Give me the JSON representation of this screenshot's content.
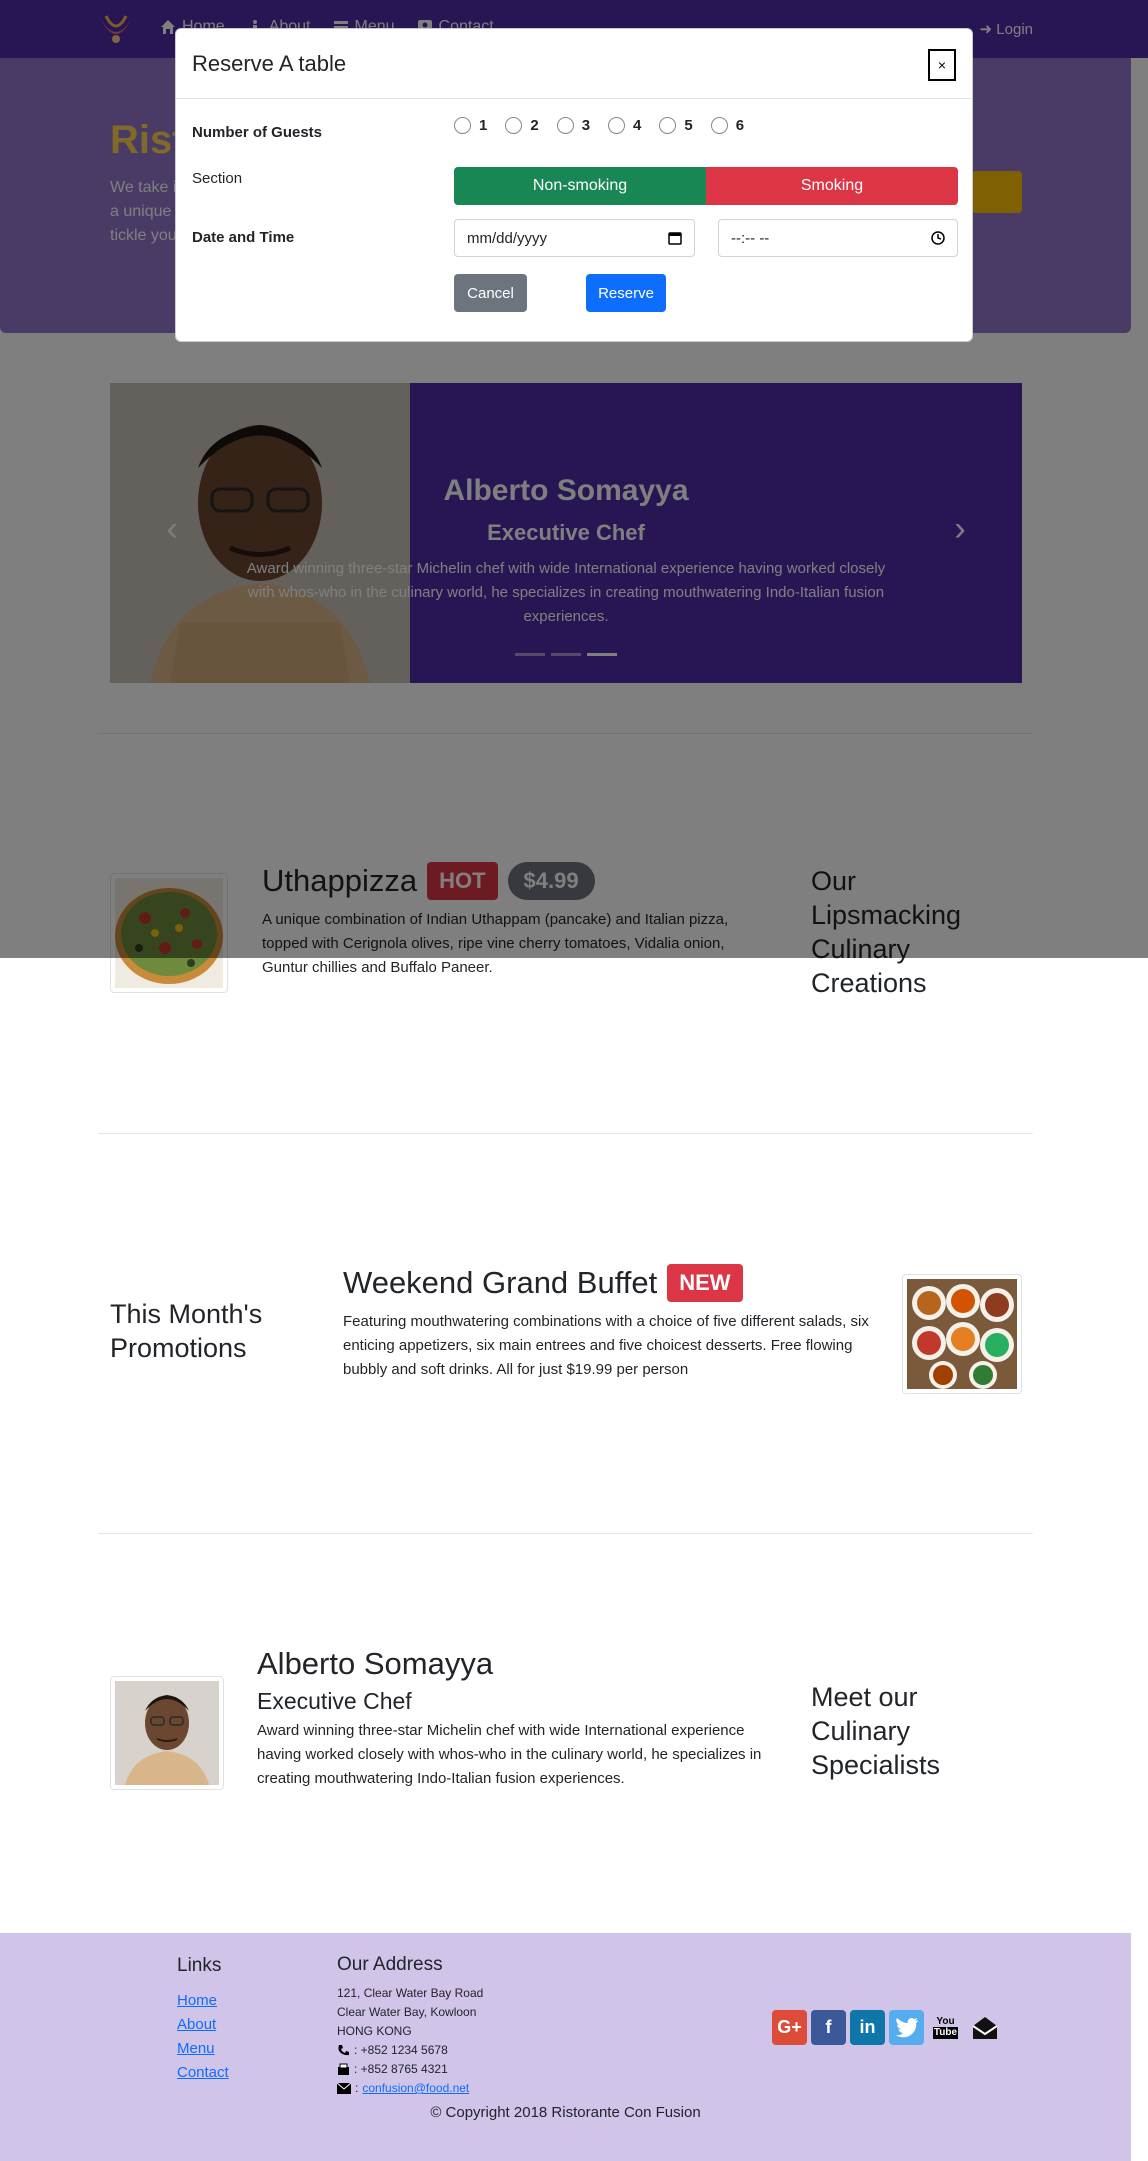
{
  "nav": {
    "items": [
      {
        "label": "Home",
        "icon": "home-icon"
      },
      {
        "label": "About",
        "icon": "info-icon"
      },
      {
        "label": "Menu",
        "icon": "list-icon"
      },
      {
        "label": "Contact",
        "icon": "address-card-icon"
      }
    ],
    "login": "Login"
  },
  "jumbotron": {
    "title": "Rist",
    "text_lines": [
      "We take i",
      "a unique",
      "tickle you"
    ]
  },
  "carousel": {
    "title": "Alberto Somayya",
    "subtitle": "Executive Chef",
    "text": "Award winning three-star Michelin chef with wide International experience having worked closely with whos-who in the culinary world, he specializes in creating mouthwatering Indo-Italian fusion experiences.",
    "active_slide": 3,
    "slide_count": 3
  },
  "dish": {
    "name": "Uthappizza",
    "badge": "HOT",
    "price": "$4.99",
    "description": "A unique combination of Indian Uthappam (pancake) and Italian pizza, topped with Cerignola olives, ripe vine cherry tomatoes, Vidalia onion, Guntur chillies and Buffalo Paneer.",
    "side_heading": [
      "Our",
      "Lipsmacking",
      "Culinary",
      "Creations"
    ]
  },
  "promotion": {
    "side_heading": [
      "This Month's",
      "Promotions"
    ],
    "name": "Weekend Grand Buffet",
    "badge": "NEW",
    "description": "Featuring mouthwatering combinations with a choice of five different salads, six enticing appetizers, six main entrees and five choicest desserts. Free flowing bubbly and soft drinks. All for just $19.99 per person"
  },
  "leader": {
    "name": "Alberto Somayya",
    "designation": "Executive Chef",
    "description": "Award winning three-star Michelin chef with wide International experience having worked closely with whos-who in the culinary world, he specializes in creating mouthwatering Indo-Italian fusion experiences.",
    "side_heading": [
      "Meet our",
      "Culinary",
      "Specialists"
    ]
  },
  "footer": {
    "links_title": "Links",
    "links": [
      "Home",
      "About",
      "Menu",
      "Contact"
    ],
    "address_title": "Our Address",
    "address_lines": [
      "121, Clear Water Bay Road",
      "Clear Water Bay, Kowloon",
      "HONG KONG"
    ],
    "phone": ": +852 1234 5678",
    "fax": ": +852 8765 4321",
    "email": "confusion@food.net",
    "copyright": "© Copyright 2018 Ristorante Con Fusion"
  },
  "modal": {
    "title": "Reserve A table",
    "close": "×",
    "guests_label": "Number of Guests",
    "guest_options": [
      "1",
      "2",
      "3",
      "4",
      "5",
      "6"
    ],
    "section_label": "Section",
    "section_options": [
      "Non-smoking",
      "Smoking"
    ],
    "datetime_label": "Date and Time",
    "date_placeholder": "mm/dd/yyyy",
    "time_placeholder": "--:-- --",
    "cancel": "Cancel",
    "reserve": "Reserve"
  },
  "colors": {
    "primary": "#512da8",
    "jumbotron": "#9575cd",
    "footer": "#d1c4e9",
    "accent": "#ffc107"
  }
}
